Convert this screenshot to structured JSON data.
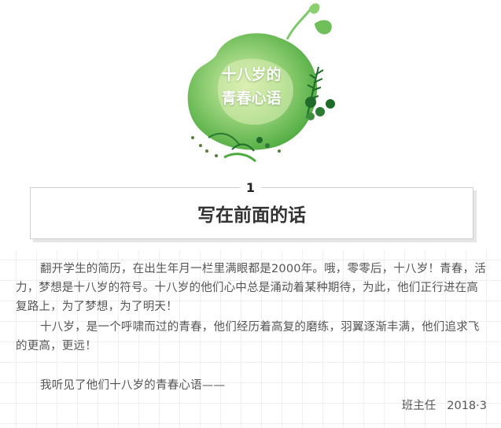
{
  "emblem": {
    "title_line1": "十八岁的",
    "title_line2": "青春心语",
    "colors": {
      "green_dark": "#4daa3f",
      "green_mid": "#7cc86a",
      "green_light": "#c8e6a2",
      "leaf": "#1f6b2a"
    }
  },
  "section": {
    "number": "1",
    "title": "写在前面的话"
  },
  "body": {
    "paragraph1": "翻开学生的简历，在出生年月一栏里满眼都是2000年。哦，零零后，十八岁！青春，活力，梦想是十八岁的符号。十八岁的他们心中总是涌动着某种期待，为此，他们正行进在高复路上，为了梦想，为了明天！",
    "paragraph2": "十八岁，是一个呼啸而过的青春，他们经历着高复的磨练，羽翼逐渐丰满，他们追求飞的更高，更远！",
    "paragraph3": "我听见了他们十八岁的青春心语——",
    "signature_name": "班主任",
    "signature_date": "2018·3"
  }
}
